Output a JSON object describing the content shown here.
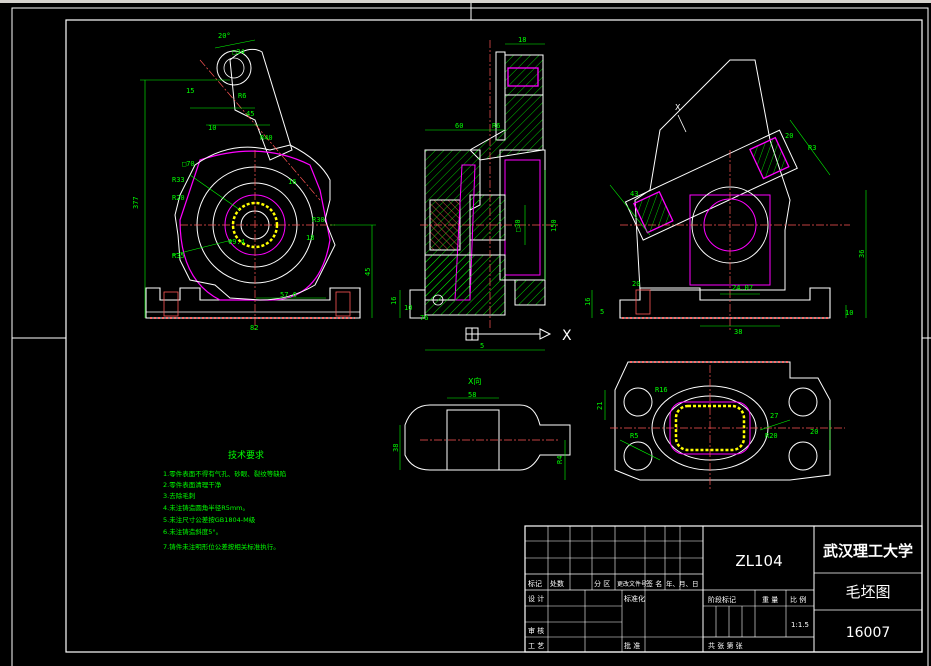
{
  "drawing": {
    "material": "ZL104",
    "university": "武汉理工大学",
    "drawing_title": "毛坯图",
    "drawing_number": "16007",
    "scale": "1:1.5"
  },
  "title_block": {
    "hdr_mark": "标记",
    "hdr_count": "处数",
    "hdr_zone": "分 区",
    "hdr_doc": "更改文件号",
    "hdr_sign": "签 名",
    "hdr_date": "年、月、日",
    "design": "设 计",
    "standardize": "标准化",
    "stage_mark": "阶段标记",
    "weight": "重 量",
    "ratio": "比 例",
    "review": "审 核",
    "process": "工 艺",
    "approve": "批 准",
    "sheets": "共  张  第  张"
  },
  "tech_notes": {
    "title": "技术要求",
    "items": [
      "1.零件表面不得有气孔、砂眼、裂纹等缺陷",
      "2.零件表面清理干净",
      "3.去除毛刺",
      "4.未注铸造圆角半径R5mm。",
      "5.未注尺寸公差按GB1804-M级",
      "6.未注铸造斜度5°。",
      "7.铸件未注明形位公差按相关标准执行。"
    ]
  },
  "labels": {
    "view_x": "X向",
    "arrow_x": "X",
    "x_mark": "X"
  },
  "dims": {
    "front": [
      "20°",
      "□34",
      "15",
      "R6",
      "45",
      "10",
      "R40",
      "□70",
      "R33",
      "377",
      "R20",
      "R30",
      "Φ9.4",
      "R35",
      "16",
      "18",
      "57.6",
      "45",
      "82"
    ],
    "side": [
      "18",
      "60",
      "R6",
      "150",
      "□30",
      "16",
      "10",
      "5",
      "76"
    ],
    "right": [
      "20",
      "R3",
      "43",
      "38",
      "36",
      "24.07",
      "16",
      "20",
      "10",
      "5"
    ],
    "xview": [
      "58",
      "38",
      "R4"
    ],
    "bottom": [
      "21",
      "R5",
      "R16",
      "27",
      "R20",
      "20"
    ]
  }
}
